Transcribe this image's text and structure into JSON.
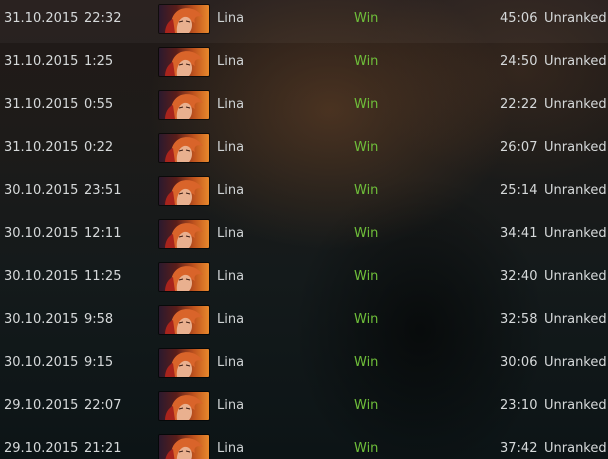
{
  "matches": [
    {
      "date": "31.10.2015",
      "time": "22:32",
      "hero": "Lina",
      "result": "Win",
      "duration": "45:06",
      "lobby": "Unranked"
    },
    {
      "date": "31.10.2015",
      "time": "1:25",
      "hero": "Lina",
      "result": "Win",
      "duration": "24:50",
      "lobby": "Unranked"
    },
    {
      "date": "31.10.2015",
      "time": "0:55",
      "hero": "Lina",
      "result": "Win",
      "duration": "22:22",
      "lobby": "Unranked"
    },
    {
      "date": "31.10.2015",
      "time": "0:22",
      "hero": "Lina",
      "result": "Win",
      "duration": "26:07",
      "lobby": "Unranked"
    },
    {
      "date": "30.10.2015",
      "time": "23:51",
      "hero": "Lina",
      "result": "Win",
      "duration": "25:14",
      "lobby": "Unranked"
    },
    {
      "date": "30.10.2015",
      "time": "12:11",
      "hero": "Lina",
      "result": "Win",
      "duration": "34:41",
      "lobby": "Unranked"
    },
    {
      "date": "30.10.2015",
      "time": "11:25",
      "hero": "Lina",
      "result": "Win",
      "duration": "32:40",
      "lobby": "Unranked"
    },
    {
      "date": "30.10.2015",
      "time": "9:58",
      "hero": "Lina",
      "result": "Win",
      "duration": "32:58",
      "lobby": "Unranked"
    },
    {
      "date": "30.10.2015",
      "time": "9:15",
      "hero": "Lina",
      "result": "Win",
      "duration": "30:06",
      "lobby": "Unranked"
    },
    {
      "date": "29.10.2015",
      "time": "22:07",
      "hero": "Lina",
      "result": "Win",
      "duration": "23:10",
      "lobby": "Unranked"
    },
    {
      "date": "29.10.2015",
      "time": "21:21",
      "hero": "Lina",
      "result": "Win",
      "duration": "37:42",
      "lobby": "Unranked"
    }
  ],
  "colors": {
    "win": "#6fbf3a",
    "text": "#d6d9da"
  },
  "icons": {
    "hero_portrait": "hero-portrait-icon"
  }
}
